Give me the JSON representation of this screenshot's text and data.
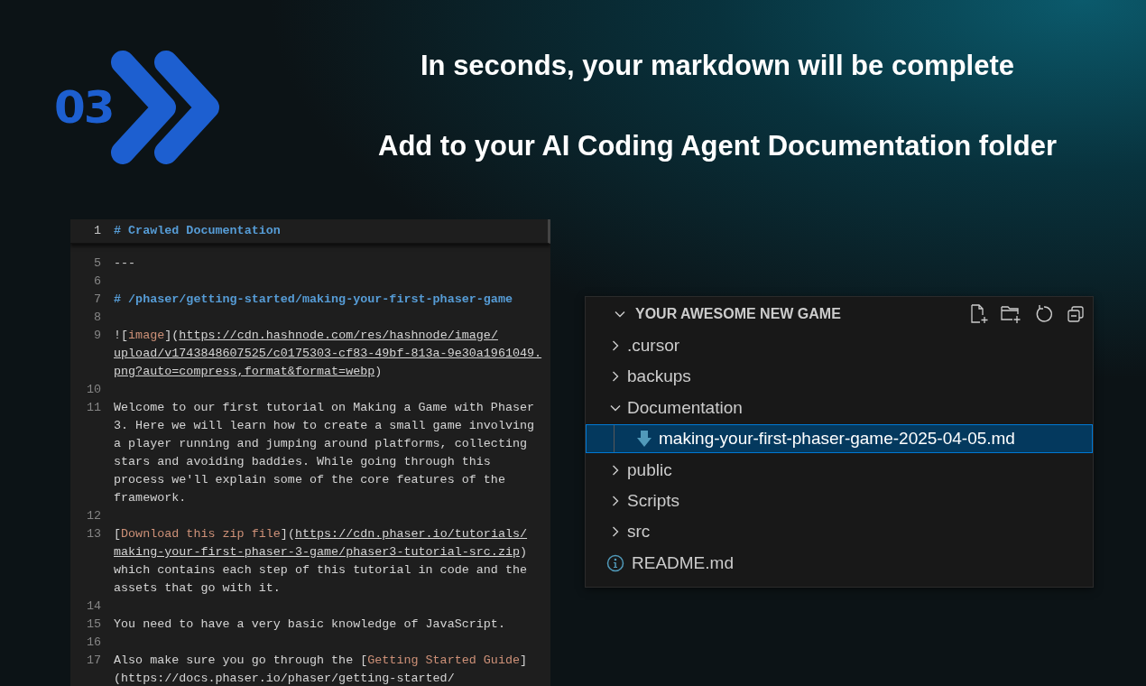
{
  "step": {
    "number": "03"
  },
  "headlines": [
    "In seconds, your markdown will be complete",
    "Add to your AI Coding Agent Documentation folder"
  ],
  "editor": {
    "sticky_line": {
      "number": "1",
      "rows": [
        {
          "parts": [
            {
              "kind": "heading",
              "text": "# Crawled Documentation"
            }
          ]
        }
      ]
    },
    "lines": [
      {
        "number": "5",
        "rows": [
          {
            "parts": [
              {
                "kind": "plain",
                "text": "---"
              }
            ]
          }
        ]
      },
      {
        "number": "6"
      },
      {
        "number": "7",
        "rows": [
          {
            "parts": [
              {
                "kind": "heading",
                "text": "# /phaser/getting-started/making-your-first-phaser-game"
              }
            ]
          }
        ]
      },
      {
        "number": "8"
      },
      {
        "number": "9",
        "rows": [
          {
            "parts": [
              {
                "kind": "plain",
                "text": "!["
              },
              {
                "kind": "link",
                "text": "image"
              },
              {
                "kind": "plain",
                "text": "]("
              },
              {
                "kind": "url",
                "text": "https://cdn.hashnode.com/res/hashnode/image/"
              }
            ]
          },
          {
            "parts": [
              {
                "kind": "url",
                "text": "upload/v1743848607525/c0175303-cf83-49bf-813a-9e30a1961049."
              }
            ]
          },
          {
            "parts": [
              {
                "kind": "url",
                "text": "png?auto=compress,format&format=webp"
              },
              {
                "kind": "plain",
                "text": ")"
              }
            ]
          }
        ]
      },
      {
        "number": "10"
      },
      {
        "number": "11",
        "rows": [
          {
            "parts": [
              {
                "kind": "plain",
                "text": "Welcome to our first tutorial on Making a Game with Phaser"
              }
            ]
          },
          {
            "parts": [
              {
                "kind": "plain",
                "text": "3. Here we will learn how to create a small game involving"
              }
            ]
          },
          {
            "parts": [
              {
                "kind": "plain",
                "text": "a player running and jumping around platforms, collecting"
              }
            ]
          },
          {
            "parts": [
              {
                "kind": "plain",
                "text": "stars and avoiding baddies. While going through this"
              }
            ]
          },
          {
            "parts": [
              {
                "kind": "plain",
                "text": "process we'll explain some of the core features of the"
              }
            ]
          },
          {
            "parts": [
              {
                "kind": "plain",
                "text": "framework."
              }
            ]
          }
        ]
      },
      {
        "number": "12"
      },
      {
        "number": "13",
        "rows": [
          {
            "parts": [
              {
                "kind": "plain",
                "text": "["
              },
              {
                "kind": "link",
                "text": "Download this zip file"
              },
              {
                "kind": "plain",
                "text": "]("
              },
              {
                "kind": "url",
                "text": "https://cdn.phaser.io/tutorials/"
              }
            ]
          },
          {
            "parts": [
              {
                "kind": "url",
                "text": "making-your-first-phaser-3-game/phaser3-tutorial-src.zip"
              },
              {
                "kind": "plain",
                "text": ")"
              }
            ]
          },
          {
            "parts": [
              {
                "kind": "plain",
                "text": "which contains each step of this tutorial in code and the"
              }
            ]
          },
          {
            "parts": [
              {
                "kind": "plain",
                "text": "assets that go with it."
              }
            ]
          }
        ]
      },
      {
        "number": "14"
      },
      {
        "number": "15",
        "rows": [
          {
            "parts": [
              {
                "kind": "plain",
                "text": "You need to have a very basic knowledge of JavaScript."
              }
            ]
          }
        ]
      },
      {
        "number": "16"
      },
      {
        "number": "17",
        "rows": [
          {
            "parts": [
              {
                "kind": "plain",
                "text": "Also make sure you go through the ["
              },
              {
                "kind": "link",
                "text": "Getting Started Guide"
              },
              {
                "kind": "plain",
                "text": "]"
              }
            ]
          },
          {
            "parts": [
              {
                "kind": "plain",
                "text": "(https://docs.phaser.io/phaser/getting-started/"
              }
            ]
          }
        ]
      }
    ]
  },
  "explorer": {
    "title": "YOUR AWESOME NEW GAME",
    "expanded": true,
    "items": [
      {
        "kind": "folder",
        "name": ".cursor",
        "expanded": false,
        "selected": false
      },
      {
        "kind": "folder",
        "name": "backups",
        "expanded": false,
        "selected": false
      },
      {
        "kind": "folder",
        "name": "Documentation",
        "expanded": true,
        "selected": false,
        "children": [
          {
            "kind": "markdown",
            "name": "making-your-first-phaser-game-2025-04-05.md",
            "selected": true
          }
        ]
      },
      {
        "kind": "folder",
        "name": "public",
        "expanded": false,
        "selected": false
      },
      {
        "kind": "folder",
        "name": "Scripts",
        "expanded": false,
        "selected": false
      },
      {
        "kind": "folder",
        "name": "src",
        "expanded": false,
        "selected": false
      },
      {
        "kind": "readme",
        "name": "README.md",
        "selected": false
      }
    ]
  }
}
